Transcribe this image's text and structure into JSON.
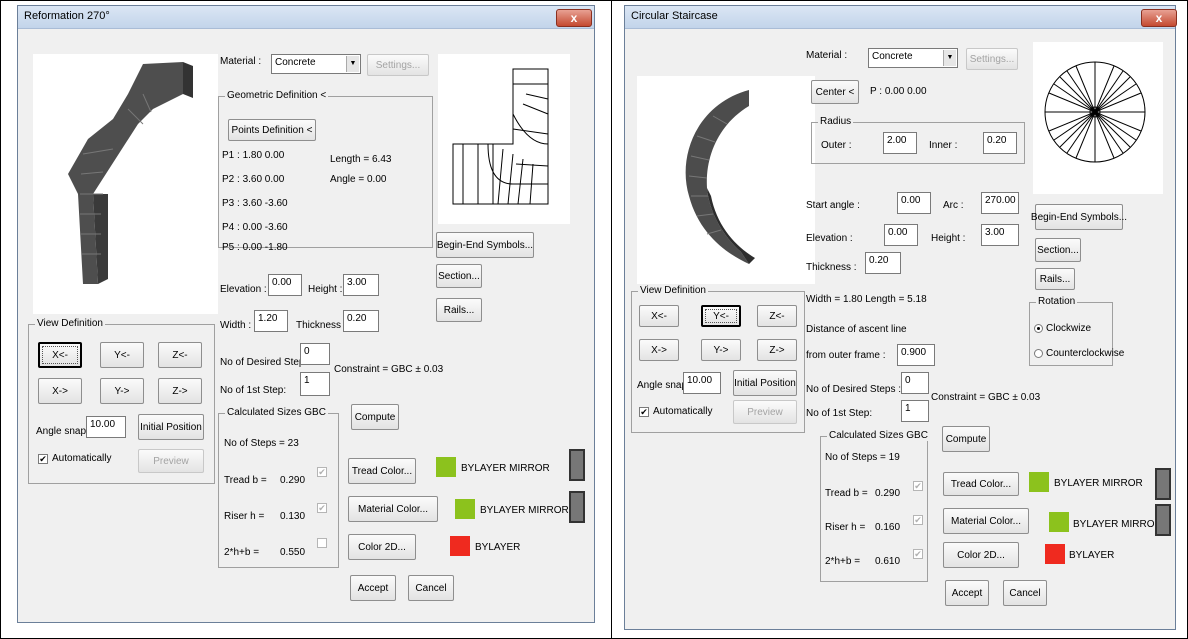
{
  "colors": {
    "green": "#8cc21d",
    "red": "#ef2a1f",
    "dialog_bg": "#f0f0f0"
  },
  "left": {
    "title": "Reformation 270°",
    "close": "x",
    "material_label": "Material :",
    "material_value": "Concrete",
    "settings": "Settings...",
    "geo_group": "Geometric Definition <",
    "points_button": "Points Definition <",
    "points": [
      "P1 :  1.80 0.00",
      "P2 :  3.60 0.00",
      "P3 :  3.60 -3.60",
      "P4 :  0.00 -3.60",
      "P5 :  0.00 -1.80"
    ],
    "length": "Length =  6.43",
    "angle": "Angle =  0.00",
    "begin_end": "Begin-End Symbols...",
    "section": "Section...",
    "rails": "Rails...",
    "elevation_label": "Elevation :",
    "elevation": "0.00",
    "height_label": "Height :",
    "height": "3.00",
    "width_label": "Width :",
    "width": "1.20",
    "thickness_label": "Thickness :",
    "thickness": "0.20",
    "desired_label": "No of Desired Steps :",
    "desired": "0",
    "constraint": "Constraint = GBC ±   0.03",
    "first_label": "No of 1st Step:",
    "first": "1",
    "view_group": "View Definition",
    "view_buttons": [
      "X<-",
      "Y<-",
      "Z<-",
      "X->",
      "Y->",
      "Z->"
    ],
    "angle_snap_label": "Angle snap:",
    "angle_snap": "10.00",
    "initial_position": "Initial Position",
    "automatically": "Automatically",
    "preview": "Preview",
    "calc_group": "Calculated Sizes    GBC",
    "compute": "Compute",
    "steps": "No of Steps = 23",
    "tread_label": "Tread b =",
    "tread": "0.290",
    "riser_label": "Riser h =",
    "riser": "0.130",
    "formula_label": "2*h+b =",
    "formula": "0.550",
    "tread_color": "Tread Color...",
    "material_color": "Material Color...",
    "color2d": "Color 2D...",
    "bylayer_mirror1": "BYLAYER MIRROR",
    "bylayer_mirror2": "BYLAYER MIRROR",
    "bylayer": "BYLAYER",
    "accept": "Accept",
    "cancel": "Cancel"
  },
  "right": {
    "title": "Circular Staircase",
    "close": "x",
    "material_label": "Material :",
    "material_value": "Concrete",
    "settings": "Settings...",
    "center": "Center <",
    "center_p": "P :  0.00 0.00",
    "radius_group": "Radius",
    "outer_label": "Outer :",
    "outer": "2.00",
    "inner_label": "Inner :",
    "inner": "0.20",
    "start_angle_label": "Start angle :",
    "start_angle": "0.00",
    "arc_label": "Arc :",
    "arc": "270.00",
    "begin_end": "Begin-End Symbols...",
    "elevation_label": "Elevation :",
    "elevation": "0.00",
    "height_label": "Height :",
    "height": "3.00",
    "section": "Section...",
    "thickness_label": "Thickness :",
    "thickness": "0.20",
    "rails": "Rails...",
    "width_length": "Width   =  1.80    Length =  5.18",
    "rotation_group": "Rotation",
    "clockwise": "Clockwize",
    "counterclockwise": "Counterclockwise",
    "ascent_label1": "Distance of ascent line",
    "ascent_label2": "from outer frame :",
    "ascent": "0.900",
    "view_group": "View Definition",
    "view_buttons": [
      "X<-",
      "Y<-",
      "Z<-",
      "X->",
      "Y->",
      "Z->"
    ],
    "angle_snap_label": "Angle snap:",
    "angle_snap": "10.00",
    "initial_position": "Initial Position",
    "automatically": "Automatically",
    "preview": "Preview",
    "desired_label": "No of Desired Steps :",
    "desired": "0",
    "constraint": "Constraint = GBC ±   0.03",
    "first_label": "No of 1st Step:",
    "first": "1",
    "calc_group": "Calculated Sizes    GBC",
    "compute": "Compute",
    "steps": "No of Steps = 19",
    "tread_label": "Tread b =",
    "tread": "0.290",
    "riser_label": "Riser h =",
    "riser": "0.160",
    "formula_label": "2*h+b =",
    "formula": "0.610",
    "tread_color": "Tread Color...",
    "material_color": "Material Color...",
    "color2d": "Color 2D...",
    "bylayer_mirror1": "BYLAYER MIRROR",
    "bylayer_mirror2": "BYLAYER MIRROR",
    "bylayer": "BYLAYER",
    "accept": "Accept",
    "cancel": "Cancel"
  }
}
